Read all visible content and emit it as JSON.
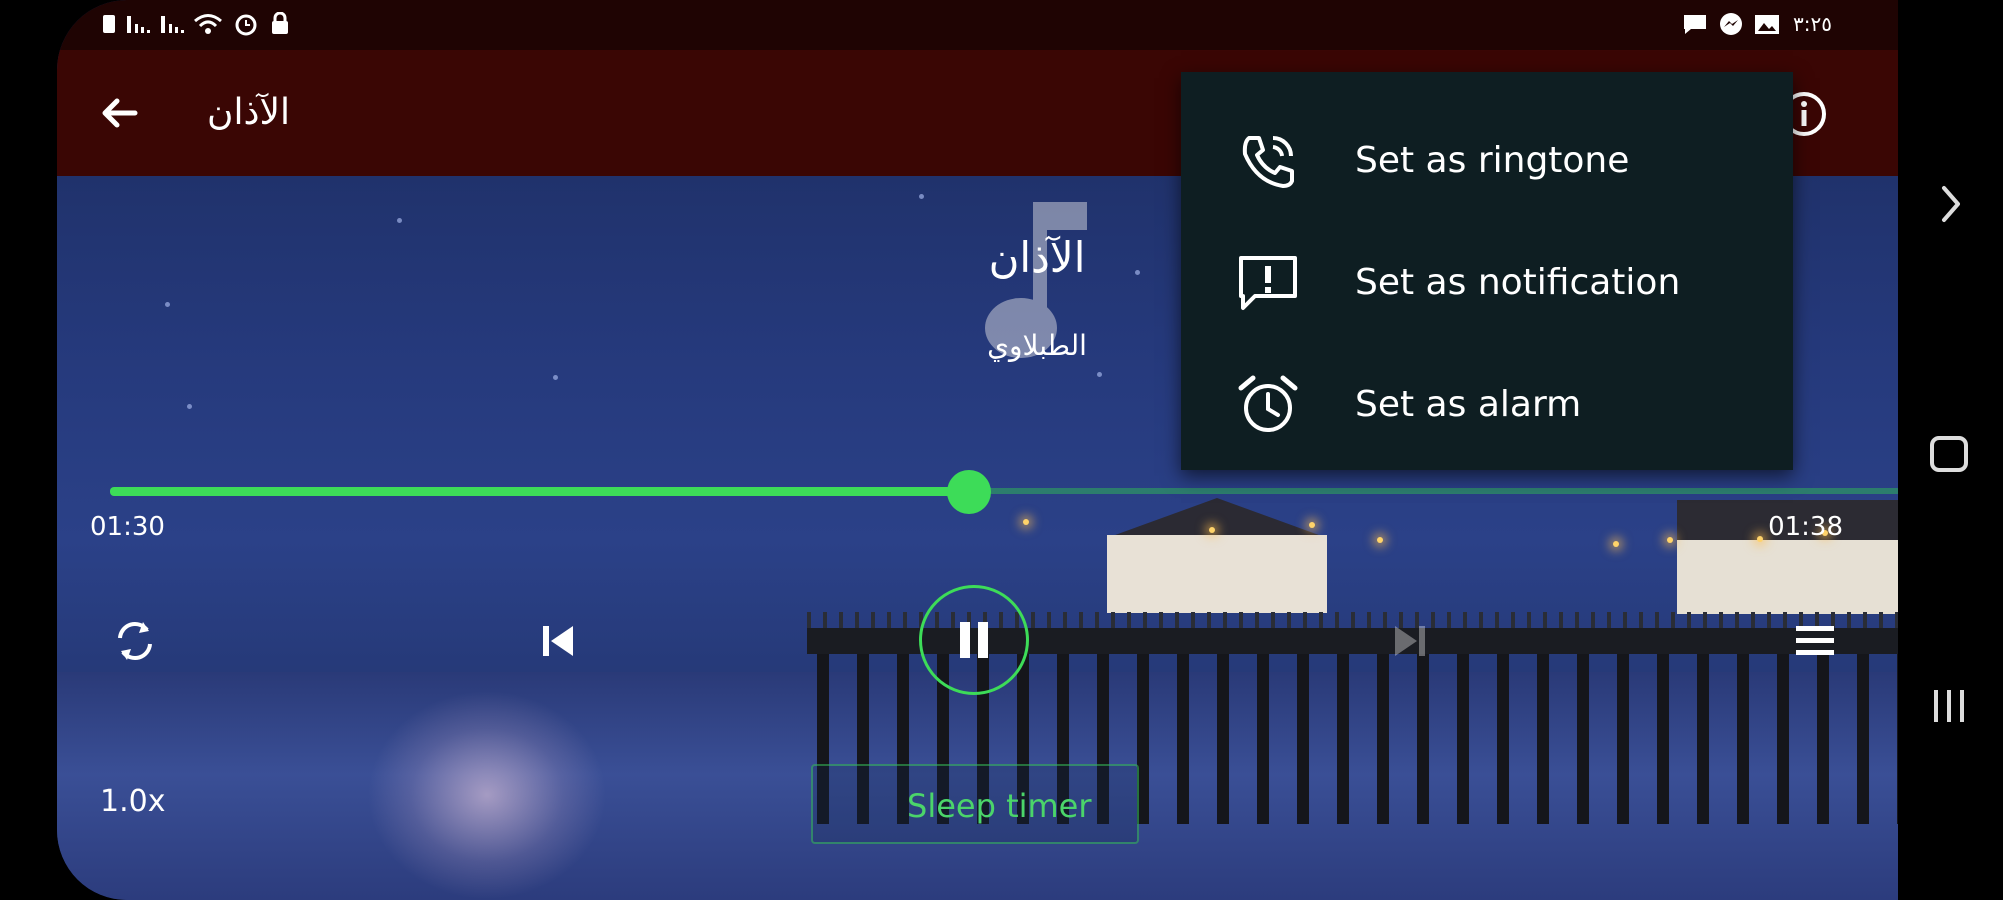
{
  "status_bar": {
    "time": "٣:٢٥",
    "left_icons": [
      "sim-icon",
      "signal-icon",
      "signal-icon",
      "wifi-icon",
      "alarm-icon",
      "vpn-lock-icon"
    ],
    "right_icons": [
      "message-icon",
      "messenger-icon",
      "gallery-icon"
    ]
  },
  "toolbar": {
    "title": "الآذان"
  },
  "track": {
    "title": "الآذان",
    "artist": "الطبلاوي"
  },
  "player": {
    "elapsed": "01:30",
    "total": "01:38",
    "progress": 0.48,
    "speed": "1.0x",
    "sleep_timer_label": "Sleep timer",
    "accent_color": "#3ddc58"
  },
  "menu": {
    "items": [
      {
        "label": "Set as ringtone",
        "icon": "phone-ringing-icon"
      },
      {
        "label": "Set as notification",
        "icon": "notification-alert-icon"
      },
      {
        "label": "Set as alarm",
        "icon": "alarm-clock-icon"
      }
    ]
  },
  "colors": {
    "status_bar": "#1f0403",
    "app_bar": "#3a0604",
    "menu_bg": "#0e1e22"
  }
}
